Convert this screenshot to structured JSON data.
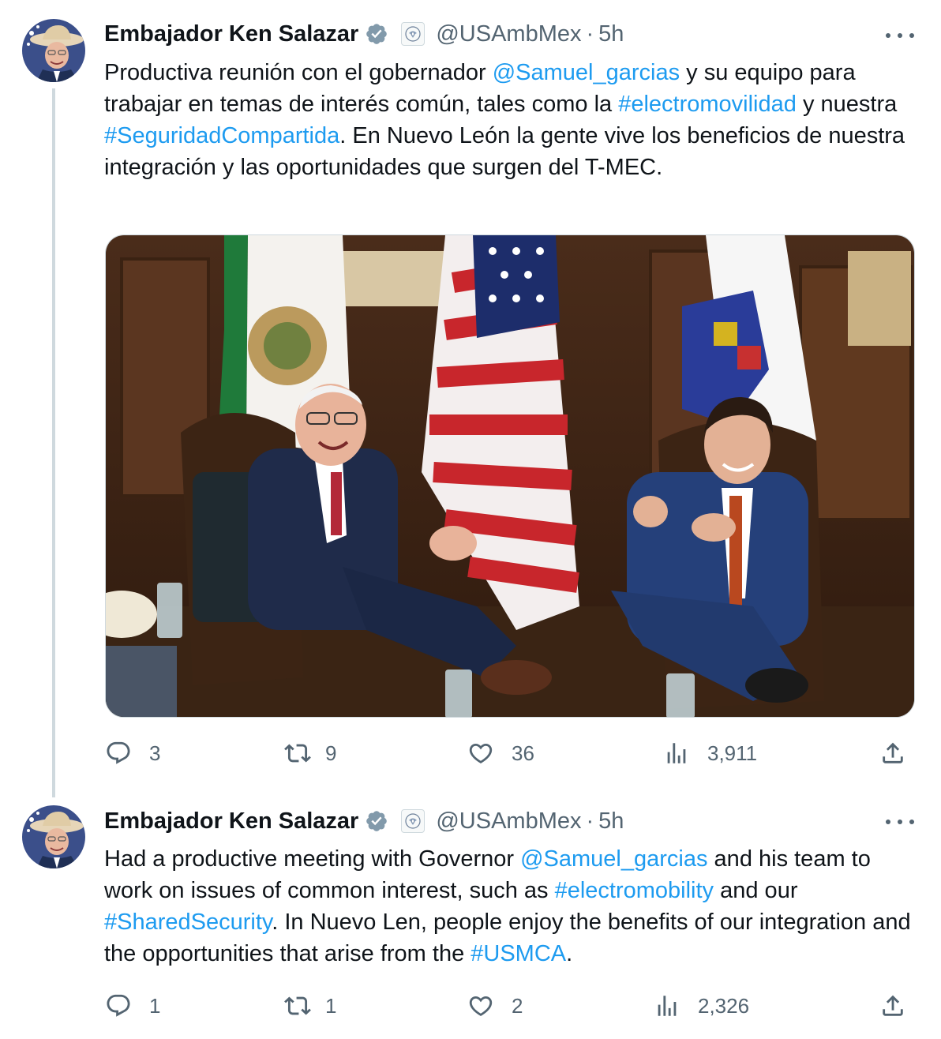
{
  "tweets": [
    {
      "author_name": "Embajador Ken Salazar",
      "handle": "@USAmbMex",
      "separator": "·",
      "time": "5h",
      "text_segments": [
        {
          "t": "Productiva reunión con el gobernador ",
          "link": false
        },
        {
          "t": "@Samuel_garcias",
          "link": true
        },
        {
          "t": " y su equipo para trabajar en temas de interés común, tales como la ",
          "link": false
        },
        {
          "t": "#electromovilidad",
          "link": true
        },
        {
          "t": " y nuestra ",
          "link": false
        },
        {
          "t": "#SeguridadCompartida",
          "link": true
        },
        {
          "t": ". En Nuevo León la gente vive los beneficios de nuestra integración y las oportunidades que surgen del T-MEC.",
          "link": false
        }
      ],
      "replies": "3",
      "retweets": "9",
      "likes": "36",
      "views": "3,911"
    },
    {
      "author_name": "Embajador Ken Salazar",
      "handle": "@USAmbMex",
      "separator": "·",
      "time": "5h",
      "text_segments": [
        {
          "t": "Had a productive meeting with Governor ",
          "link": false
        },
        {
          "t": "@Samuel_garcias",
          "link": true
        },
        {
          "t": " and his team to work on issues of common interest, such as ",
          "link": false
        },
        {
          "t": "#electromobility",
          "link": true
        },
        {
          "t": " and our ",
          "link": false
        },
        {
          "t": "#SharedSecurity",
          "link": true
        },
        {
          "t": ". In Nuevo Len, people enjoy the benefits of our integration and the opportunities that arise from the ",
          "link": false
        },
        {
          "t": "#USMCA",
          "link": true
        },
        {
          "t": ".",
          "link": false
        }
      ],
      "replies": "1",
      "retweets": "1",
      "likes": "2",
      "views": "2,326"
    }
  ],
  "icons": {
    "reply": "reply-icon",
    "retweet": "retweet-icon",
    "like": "heart-icon",
    "views": "views-icon",
    "share": "share-icon",
    "verified": "verified-badge-icon",
    "government": "us-seal-icon",
    "more": "more-options-icon"
  },
  "colors": {
    "link": "#1d9bf0",
    "muted": "#536471",
    "text": "#0f1419",
    "verified_badge": "#829aab"
  }
}
